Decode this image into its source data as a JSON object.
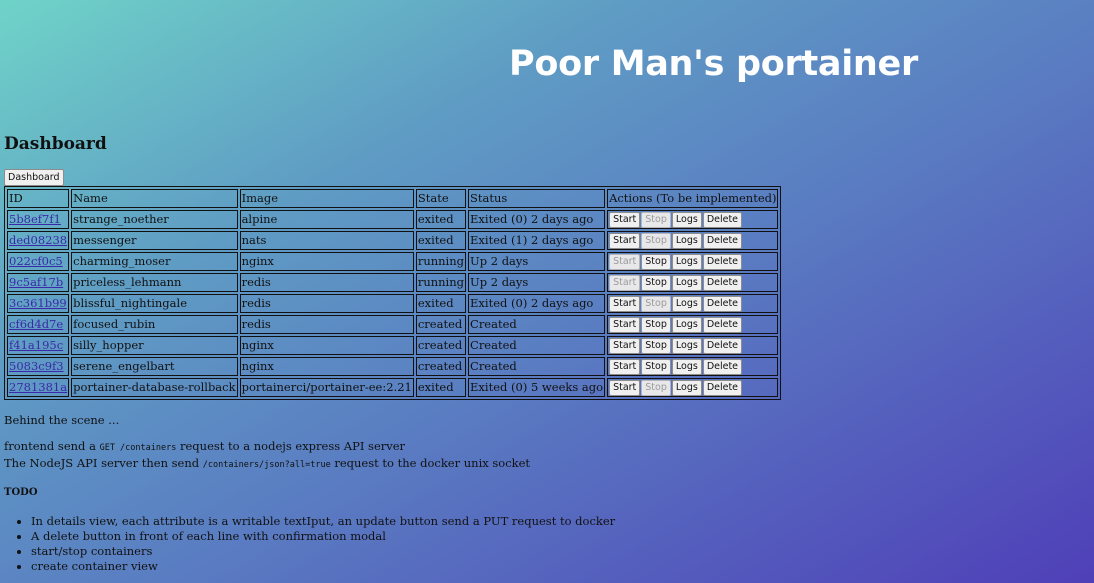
{
  "app": {
    "title": "Poor Man's portainer"
  },
  "page": {
    "heading": "Dashboard"
  },
  "nav": {
    "dashboard_button": "Dashboard"
  },
  "table": {
    "headers": [
      "ID",
      "Name",
      "Image",
      "State",
      "Status",
      "Actions (To be implemented)"
    ],
    "actions": [
      "Start",
      "Stop",
      "Logs",
      "Delete"
    ],
    "rows": [
      {
        "id": "5b8ef7f1",
        "name": "strange_noether",
        "image": "alpine",
        "state": "exited",
        "status": "Exited (0) 2 days ago"
      },
      {
        "id": "ded08238",
        "name": "messenger",
        "image": "nats",
        "state": "exited",
        "status": "Exited (1) 2 days ago"
      },
      {
        "id": "022cf0c5",
        "name": "charming_moser",
        "image": "nginx",
        "state": "running",
        "status": "Up 2 days"
      },
      {
        "id": "9c5af17b",
        "name": "priceless_lehmann",
        "image": "redis",
        "state": "running",
        "status": "Up 2 days"
      },
      {
        "id": "3c361b99",
        "name": "blissful_nightingale",
        "image": "redis",
        "state": "exited",
        "status": "Exited (0) 2 days ago"
      },
      {
        "id": "cf6d4d7e",
        "name": "focused_rubin",
        "image": "redis",
        "state": "created",
        "status": "Created"
      },
      {
        "id": "f41a195c",
        "name": "silly_hopper",
        "image": "nginx",
        "state": "created",
        "status": "Created"
      },
      {
        "id": "5083c9f3",
        "name": "serene_engelbart",
        "image": "nginx",
        "state": "created",
        "status": "Created"
      },
      {
        "id": "2781381a",
        "name": "portainer-database-rollback",
        "image": "portainerci/portainer-ee:2.21",
        "state": "exited",
        "status": "Exited (0) 5 weeks ago"
      }
    ]
  },
  "notes": {
    "behind": "Behind the scene ...",
    "line1_prefix": "frontend send a ",
    "line1_code": "GET /containers",
    "line1_suffix": " request to a nodejs express API server",
    "line2_prefix": "The NodeJS API server then send ",
    "line2_code": "/containers/json?all=true",
    "line2_suffix": " request to the docker unix socket"
  },
  "todo": {
    "title": "TODO",
    "items": [
      "In details view, each attribute is a writable textIput, an update button send a PUT request to docker",
      "A delete button in front of each line with confirmation modal",
      "start/stop containers",
      "create container view"
    ]
  },
  "colors": {
    "gradient_start": "#6fd3c8",
    "gradient_end": "#4f3fb8",
    "link": "#3b2aa8",
    "title": "#ffffff"
  }
}
